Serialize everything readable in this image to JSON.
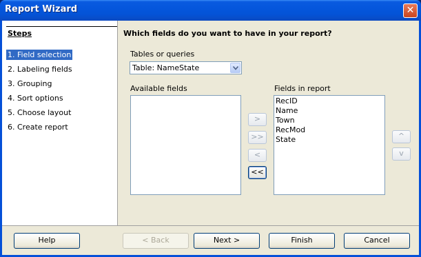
{
  "window": {
    "title": "Report Wizard",
    "close_glyph": "✕"
  },
  "steps": {
    "title": "Steps",
    "items": [
      {
        "label": "1. Field selection",
        "active": true
      },
      {
        "label": "2. Labeling fields"
      },
      {
        "label": "3. Grouping"
      },
      {
        "label": "4. Sort options"
      },
      {
        "label": "5. Choose layout"
      },
      {
        "label": "6. Create report"
      }
    ]
  },
  "main": {
    "heading": "Which fields do you want to have in your report?",
    "tables_label": "Tables or queries",
    "table_selected": "Table: NameState",
    "available_label": "Available fields",
    "fields_label": "Fields in report",
    "available_fields": [],
    "report_fields": [
      "RecID",
      "Name",
      "Town",
      "RecMod",
      "State"
    ]
  },
  "transfer_buttons": {
    "add_one": ">",
    "add_all": ">>",
    "remove_one": "<",
    "remove_all": "<<",
    "move_up": "^",
    "move_down": "v"
  },
  "buttons": {
    "help": "Help",
    "back": "< Back",
    "next": "Next >",
    "finish": "Finish",
    "cancel": "Cancel"
  }
}
